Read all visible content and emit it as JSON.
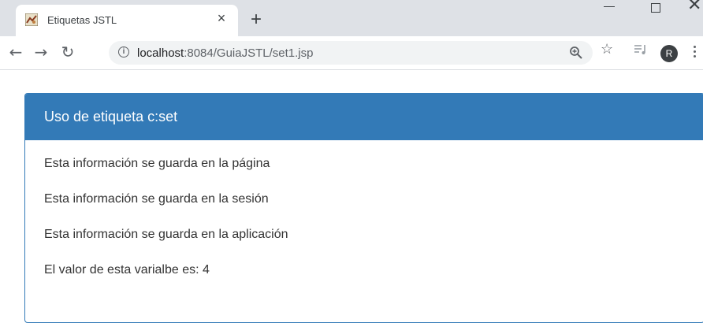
{
  "browser": {
    "tab_title": "Etiquetas JSTL",
    "tab_close": "×",
    "new_tab": "+",
    "url_host": "localhost",
    "url_path": ":8084/GuiaJSTL/set1.jsp",
    "avatar_letter": "R",
    "icons": [
      "favicon-icon",
      "close-icon",
      "plus-icon",
      "minimize-icon",
      "maximize-icon",
      "window-close-icon",
      "back-arrow-icon",
      "forward-arrow-icon",
      "reload-icon",
      "info-icon",
      "zoom-icon",
      "star-icon",
      "media-icon",
      "menu-icon"
    ]
  },
  "page": {
    "panel_title": "Uso de etiqueta c:set",
    "lines": [
      "Esta información se guarda en la página",
      "Esta información se guarda en la sesión",
      "Esta información se guarda en la aplicación",
      "El valor de esta varialbe es: 4"
    ]
  },
  "colors": {
    "panel_primary": "#337ab7",
    "tabstrip": "#dee1e6",
    "omnibox": "#f1f3f4"
  }
}
